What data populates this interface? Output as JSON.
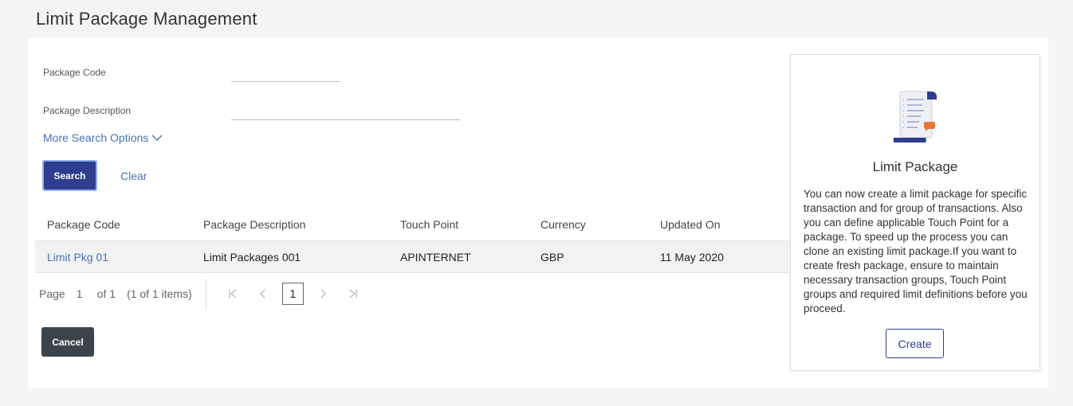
{
  "page": {
    "title": "Limit Package Management"
  },
  "search": {
    "package_code_label": "Package Code",
    "package_code_value": "",
    "package_description_label": "Package Description",
    "package_description_value": "",
    "more_options": "More Search Options",
    "search_button": "Search",
    "clear_button": "Clear"
  },
  "table": {
    "columns": [
      "Package Code",
      "Package Description",
      "Touch Point",
      "Currency",
      "Updated On"
    ],
    "rows": [
      {
        "code": "Limit Pkg 01",
        "description": "Limit Packages 001",
        "touch_point": "APINTERNET",
        "currency": "GBP",
        "updated_on": "11 May 2020"
      }
    ]
  },
  "pagination": {
    "page_label": "Page",
    "page_value": "1",
    "of_total": "of 1",
    "items_summary": "(1 of 1 items)",
    "current_page": "1"
  },
  "actions": {
    "cancel": "Cancel"
  },
  "help": {
    "title": "Limit Package",
    "text": "You can now create a limit package for specific transaction and for group of transactions. Also you can define applicable Touch Point for a package. To speed up the process you can clone an existing limit package.If you want to create fresh package, ensure to maintain necessary transaction groups, Touch Point groups and required limit definitions before you proceed.",
    "create_button": "Create",
    "icon": "document-list-icon"
  },
  "colors": {
    "primary": "#2e3d8d",
    "link": "#4a72b2",
    "cancel": "#3d434a",
    "accent": "#e8793c"
  }
}
